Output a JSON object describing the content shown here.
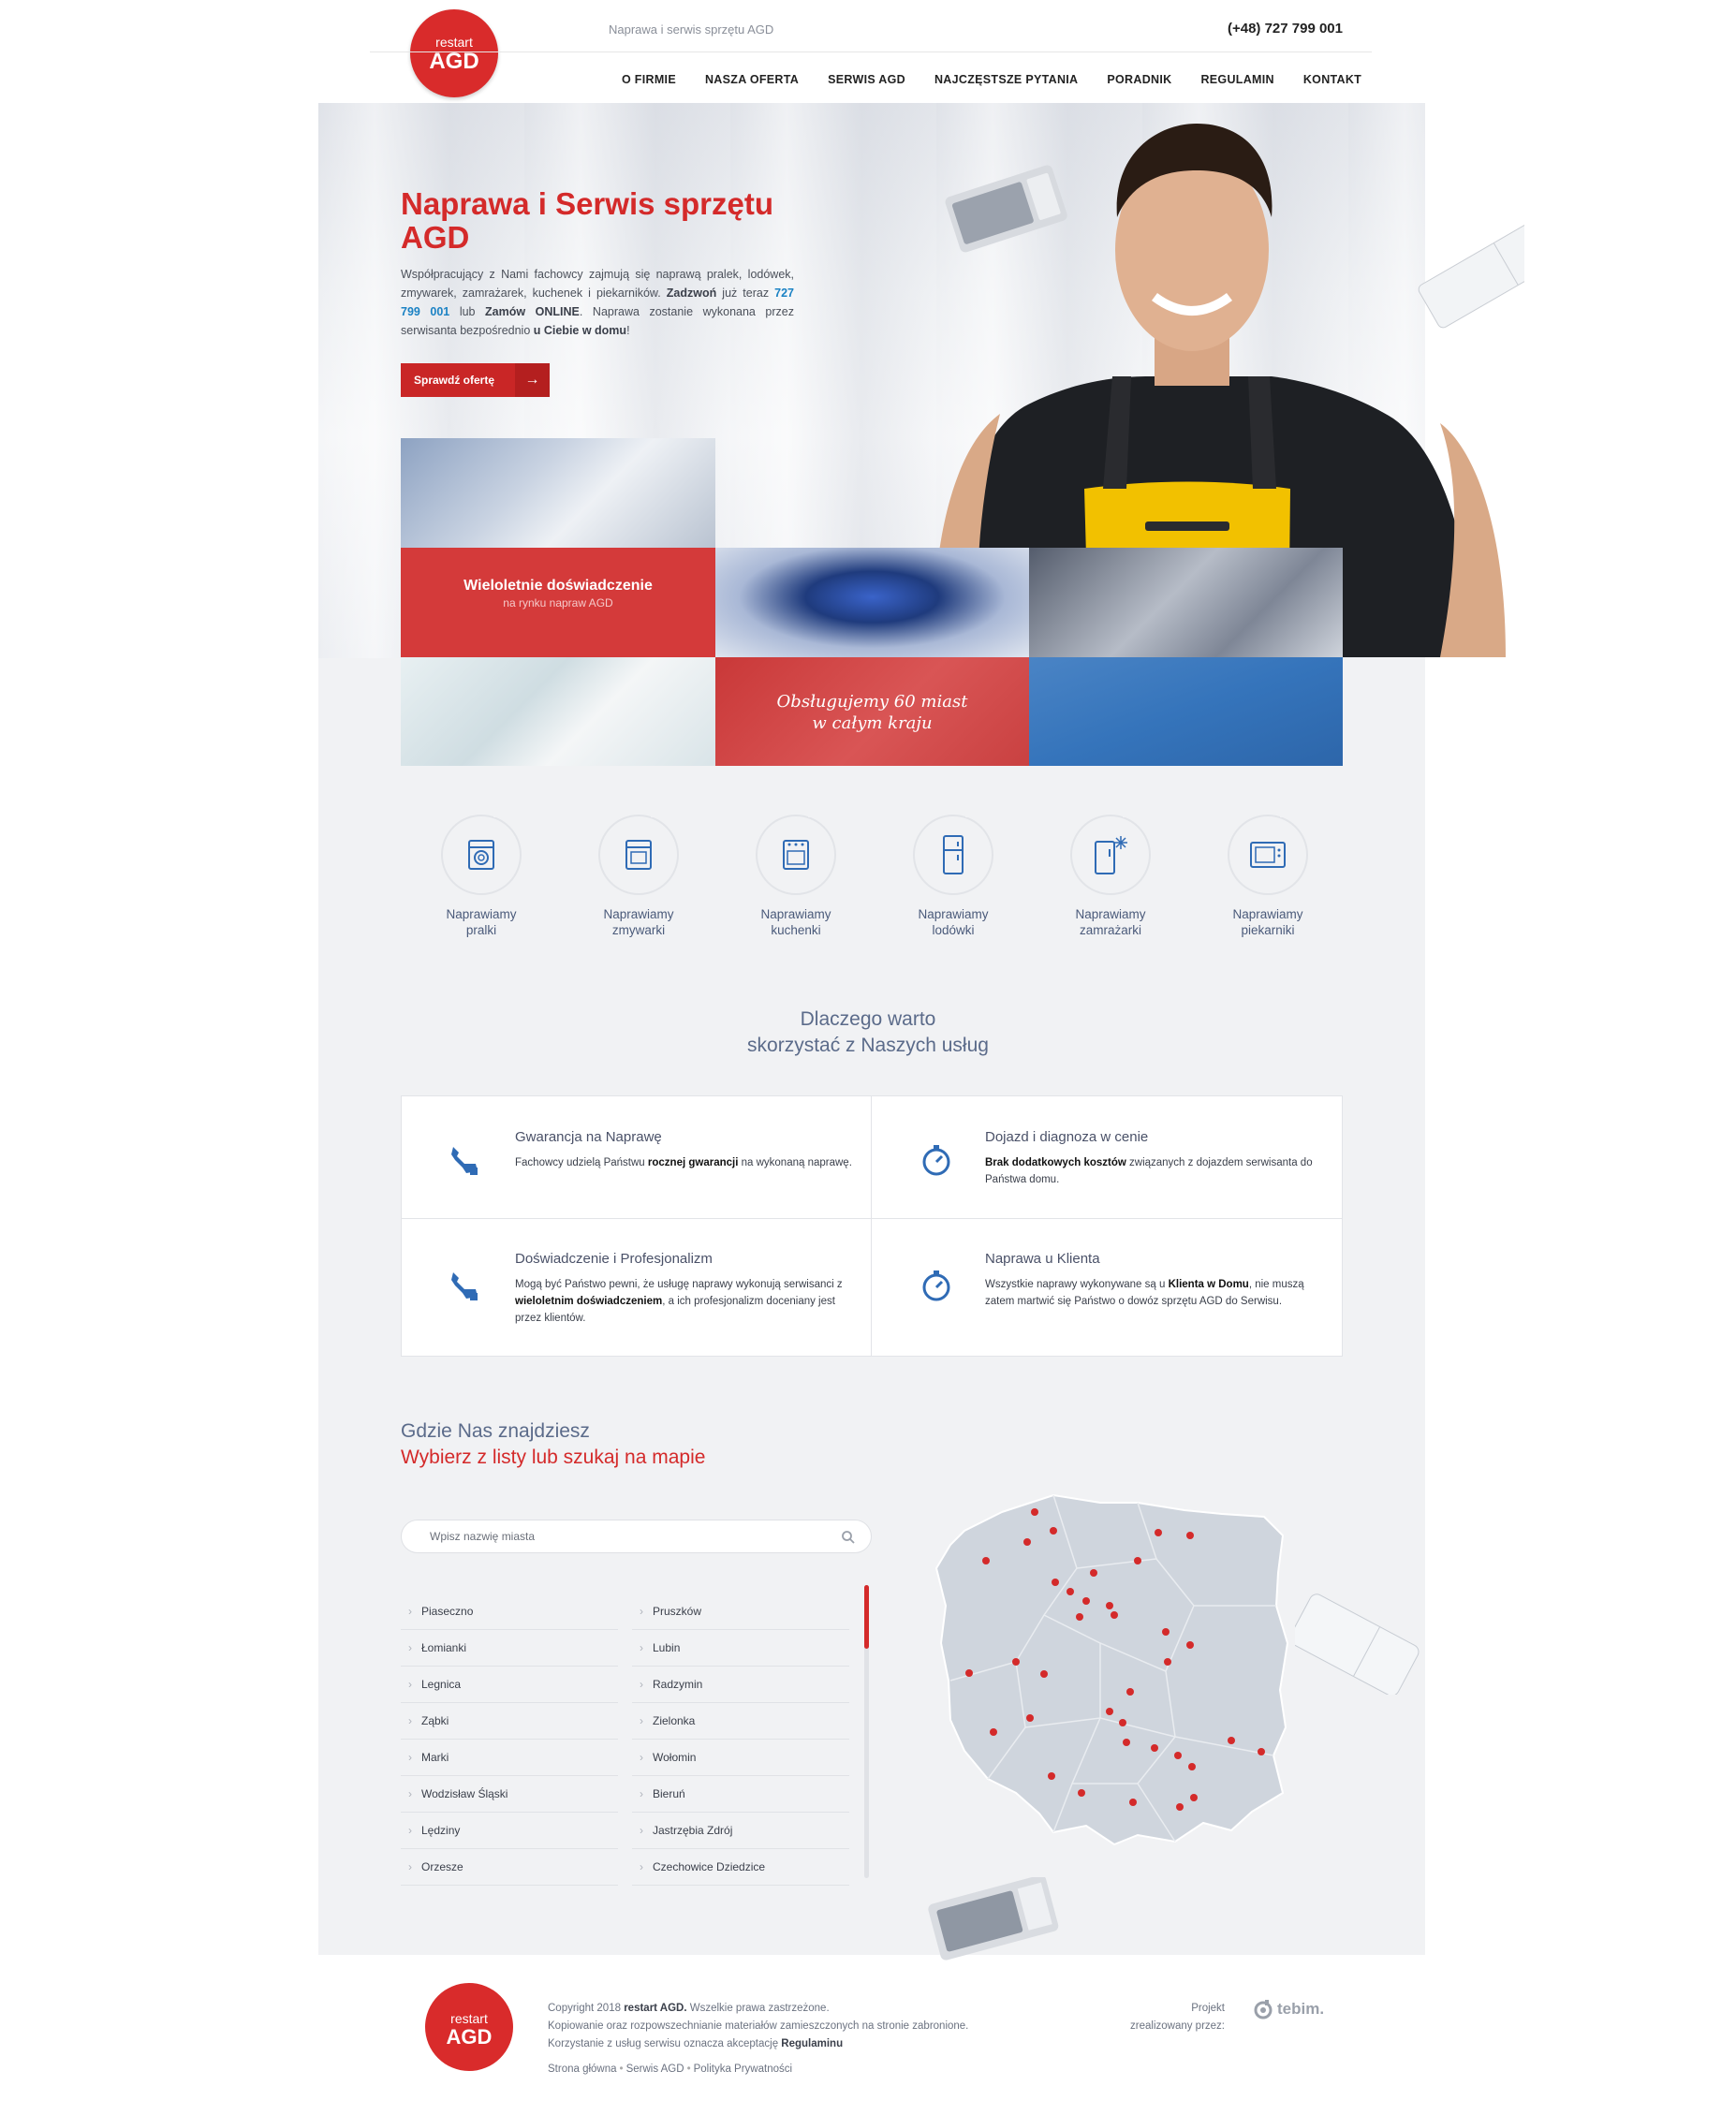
{
  "header": {
    "logo_top": "restart",
    "logo_bottom": "AGD",
    "tagline": "Naprawa i serwis sprzętu AGD",
    "phone": "(+48) 727 799 001",
    "nav": [
      "O FIRMIE",
      "NASZA OFERTA",
      "SERWIS AGD",
      "NAJCZĘSTSZE PYTANIA",
      "PORADNIK",
      "REGULAMIN",
      "KONTAKT"
    ]
  },
  "hero": {
    "title": "Naprawa i Serwis sprzętu AGD",
    "text_1": "Współpracujący z Nami fachowcy zajmują się naprawą pralek, lodówek, zmywarek, zamrażarek, kuchenek i piekarników. ",
    "text_zadzwon": "Zadzwoń",
    "text_2": " już teraz ",
    "text_tel": "727 799 001",
    "text_3": " lub ",
    "text_online": "Zamów ONLINE",
    "text_4": ". Naprawa zostanie wykonana przez serwisanta bezpośrednio ",
    "text_home": "u Ciebie w domu",
    "text_5": "!",
    "button": "Sprawdź ofertę",
    "button_arrow": "→"
  },
  "tiles": {
    "experience_title": "Wieloletnie doświadczenie",
    "experience_sub": "na rynku napraw AGD",
    "cities_line1": "Obsługujemy 60 miast",
    "cities_line2": "w całym kraju"
  },
  "services": [
    {
      "l1": "Naprawiamy",
      "l2": "pralki",
      "icon": "washing-machine-icon"
    },
    {
      "l1": "Naprawiamy",
      "l2": "zmywarki",
      "icon": "dishwasher-icon"
    },
    {
      "l1": "Naprawiamy",
      "l2": "kuchenki",
      "icon": "stove-icon"
    },
    {
      "l1": "Naprawiamy",
      "l2": "lodówki",
      "icon": "fridge-icon"
    },
    {
      "l1": "Naprawiamy",
      "l2": "zamrażarki",
      "icon": "freezer-icon"
    },
    {
      "l1": "Naprawiamy",
      "l2": "piekarniki",
      "icon": "oven-icon"
    }
  ],
  "why": {
    "line1": "Dlaczego warto",
    "line2": "skorzystać z Naszych usług"
  },
  "features": [
    {
      "title": "Gwarancja na Naprawę",
      "t1": "Fachowcy udzielą Państwu ",
      "b": "rocznej gwarancji",
      "t2": " na wykonaną naprawę.",
      "icon": "tool-icon"
    },
    {
      "title": "Dojazd i diagnoza w cenie",
      "t1": "",
      "b": "Brak dodatkowych kosztów",
      "t2": " związanych z dojazdem serwisanta do Państwa domu.",
      "icon": "stopwatch-icon"
    },
    {
      "title": "Doświadczenie i Profesjonalizm",
      "t1": "Mogą być Państwo pewni, że usługę naprawy wykonują serwisanci z ",
      "b": "wieloletnim doświadczeniem",
      "t2": ", a ich profesjonalizm doceniany jest przez klientów.",
      "icon": "tool-icon"
    },
    {
      "title": "Naprawa u Klienta",
      "t1": "Wszystkie naprawy wykonywane są u ",
      "b": "Klienta w Domu",
      "t2": ", nie muszą zatem martwić się Państwo o dowóz sprzętu AGD do Serwisu.",
      "icon": "stopwatch-icon"
    }
  ],
  "where": {
    "line1": "Gdzie Nas znajdziesz",
    "line2": "Wybierz z listy lub szukaj na mapie",
    "search_placeholder": "Wpisz nazwię miasta",
    "cities_left": [
      "Piaseczno",
      "Łomianki",
      "Legnica",
      "Ząbki",
      "Marki",
      "Wodzisław Śląski",
      "Lędziny",
      "Orzesze"
    ],
    "cities_right": [
      "Pruszków",
      "Lubin",
      "Radzymin",
      "Zielonka",
      "Wołomin",
      "Bieruń",
      "Jastrzębia Zdrój",
      "Czechowice Dziedzice"
    ]
  },
  "colors": {
    "brand_red": "#d42a2a",
    "accent_blue": "#1b82c4",
    "icon_blue": "#2f6bb5",
    "map_fill": "#cfd5dd",
    "map_dot": "#d42a2a"
  },
  "footer": {
    "logo_top": "restart",
    "logo_bottom": "AGD",
    "copy_1": "Copyright 2018 ",
    "copy_brand": "restart AGD.",
    "copy_2": " Wszelkie prawa zastrzeżone.",
    "line2": "Kopiowanie oraz rozpowszechnianie materiałów zamieszczonych na stronie zabronione.",
    "line3_a": "Korzystanie z usług serwisu oznacza akceptację ",
    "line3_b": "Regulaminu",
    "links": [
      "Strona główna",
      "Serwis AGD",
      "Polityka Prywatności"
    ],
    "link_sep": "•",
    "project_l1": "Projekt",
    "project_l2": "zrealizowany przez:",
    "tebim": "tebim."
  }
}
